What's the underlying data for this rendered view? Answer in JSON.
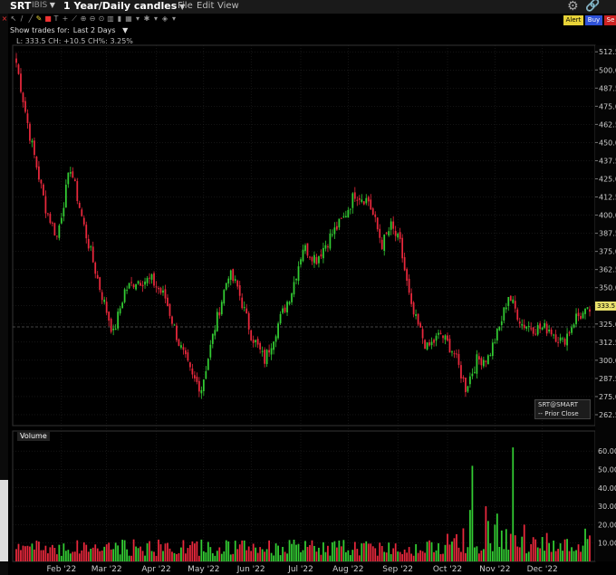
{
  "header": {
    "symbol": "SRT",
    "exchange": "IBIS",
    "period": "1 Year/Daily candles",
    "menu": [
      "File",
      "Edit",
      "View"
    ],
    "icons": [
      "gear-icon",
      "link-icon"
    ],
    "actions": {
      "alert": "Alert",
      "buy": "Buy",
      "sell": "Se"
    }
  },
  "trades": {
    "label": "Show trades for:",
    "value": "Last 2 Days"
  },
  "info": "L: 333.5 CH: +10.5 CH%: 3.25%",
  "legend": {
    "title": "SRT@SMART",
    "prior": "-- Prior Close"
  },
  "volume_label": "Volume",
  "price_tag": "333.5",
  "colors": {
    "up": "#33cc33",
    "down": "#e8283c",
    "bg": "#000000",
    "grid": "#2a2a2a",
    "axis_text": "#cccccc"
  },
  "chart_data": [
    {
      "type": "candlestick",
      "title": "SRT 1 Year/Daily candles",
      "x_ticks": [
        "Feb '22",
        "Mar '22",
        "Apr '22",
        "May '22",
        "Jun '22",
        "Jul '22",
        "Aug '22",
        "Sep '22",
        "Oct '22",
        "Nov '22",
        "Dec '22"
      ],
      "y_ticks": [
        262.5,
        275.0,
        287.5,
        300.0,
        312.5,
        325.0,
        337.5,
        350.0,
        362.5,
        375.0,
        387.5,
        400.0,
        412.5,
        425.0,
        437.5,
        450.0,
        462.5,
        475.0,
        487.5,
        500.0,
        512.5
      ],
      "ylim": [
        255,
        517
      ],
      "prior_close": 323,
      "last": 333.5,
      "anchors": [
        [
          0,
          505
        ],
        [
          6,
          455
        ],
        [
          13,
          405
        ],
        [
          18,
          385
        ],
        [
          24,
          433
        ],
        [
          30,
          392
        ],
        [
          37,
          350
        ],
        [
          43,
          318
        ],
        [
          48,
          348
        ],
        [
          53,
          355
        ],
        [
          60,
          355
        ],
        [
          66,
          343
        ],
        [
          72,
          312
        ],
        [
          78,
          288
        ],
        [
          82,
          281
        ],
        [
          88,
          323
        ],
        [
          94,
          360
        ],
        [
          98,
          350
        ],
        [
          104,
          318
        ],
        [
          110,
          300
        ],
        [
          116,
          325
        ],
        [
          122,
          348
        ],
        [
          127,
          378
        ],
        [
          133,
          370
        ],
        [
          139,
          385
        ],
        [
          145,
          398
        ],
        [
          150,
          415
        ],
        [
          156,
          410
        ],
        [
          162,
          380
        ],
        [
          166,
          392
        ],
        [
          170,
          380
        ],
        [
          175,
          335
        ],
        [
          182,
          308
        ],
        [
          188,
          318
        ],
        [
          194,
          305
        ],
        [
          199,
          281
        ],
        [
          204,
          300
        ],
        [
          209,
          302
        ],
        [
          214,
          322
        ],
        [
          218,
          345
        ],
        [
          224,
          325
        ],
        [
          230,
          322
        ],
        [
          236,
          322
        ],
        [
          242,
          312
        ],
        [
          248,
          330
        ],
        [
          254,
          333
        ]
      ]
    },
    {
      "type": "bar",
      "title": "Volume",
      "y_ticks": [
        10.0,
        20.0,
        30.0,
        40.0,
        50.0,
        60.0
      ],
      "ylim": [
        0,
        65
      ],
      "spikes": [
        [
          198,
          18
        ],
        [
          201,
          28
        ],
        [
          202,
          52
        ],
        [
          208,
          30
        ],
        [
          209,
          22
        ],
        [
          212,
          20
        ],
        [
          213,
          26
        ],
        [
          219,
          15
        ],
        [
          220,
          62
        ],
        [
          225,
          20
        ],
        [
          230,
          12
        ],
        [
          236,
          10
        ]
      ]
    }
  ]
}
